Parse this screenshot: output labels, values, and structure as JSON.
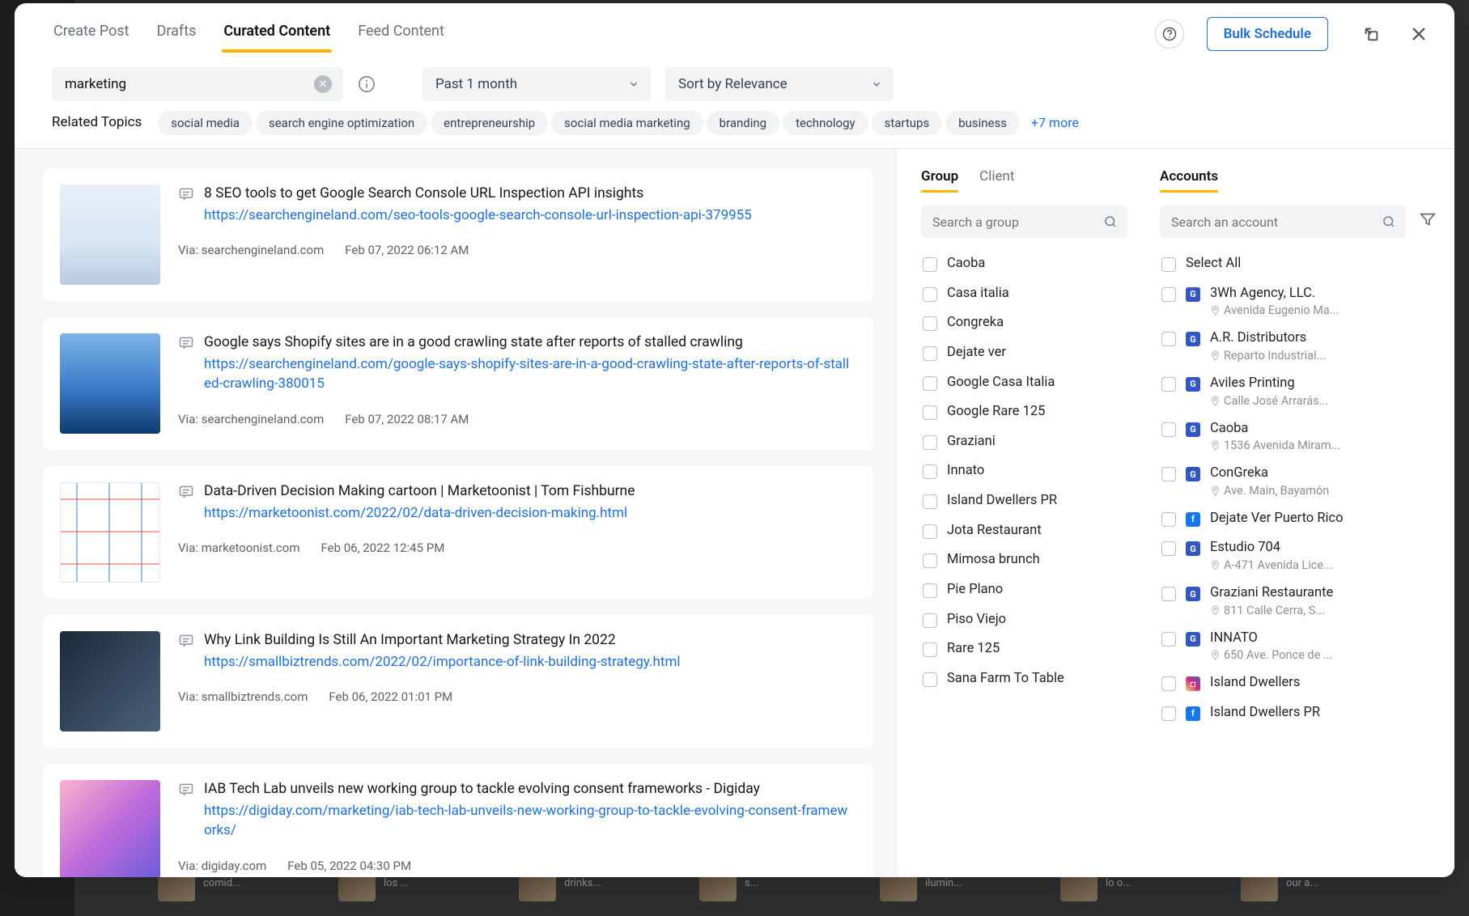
{
  "header": {
    "tabs": [
      "Create Post",
      "Drafts",
      "Curated Content",
      "Feed Content"
    ],
    "active_tab": 2,
    "bulk_schedule": "Bulk Schedule"
  },
  "search": {
    "value": "marketing",
    "time_filter": "Past 1 month",
    "sort": "Sort by Relevance"
  },
  "topics": {
    "label": "Related Topics",
    "items": [
      "social media",
      "search engine optimization",
      "entrepreneurship",
      "social media marketing",
      "branding",
      "technology",
      "startups",
      "business"
    ],
    "more": "+7 more"
  },
  "results": [
    {
      "title": "8 SEO tools to get Google Search Console URL Inspection API insights",
      "url": "https://searchengineland.com/seo-tools-google-search-console-url-inspection-api-379955",
      "via": "Via: searchengineland.com",
      "date": "Feb 07, 2022 06:12 AM",
      "thumb": "th1"
    },
    {
      "title": "Google says Shopify sites are in a good crawling state after reports of stalled crawling",
      "url": "https://searchengineland.com/google-says-shopify-sites-are-in-a-good-crawling-state-after-reports-of-stalled-crawling-380015",
      "via": "Via: searchengineland.com",
      "date": "Feb 07, 2022 08:17 AM",
      "thumb": "th2"
    },
    {
      "title": "Data-Driven Decision Making cartoon | Marketoonist | Tom Fishburne",
      "url": "https://marketoonist.com/2022/02/data-driven-decision-making.html",
      "via": "Via: marketoonist.com",
      "date": "Feb 06, 2022 12:45 PM",
      "thumb": "th3"
    },
    {
      "title": "Why Link Building Is Still An Important Marketing Strategy In 2022",
      "url": "https://smallbiztrends.com/2022/02/importance-of-link-building-strategy.html",
      "via": "Via: smallbiztrends.com",
      "date": "Feb 06, 2022 01:01 PM",
      "thumb": "th4"
    },
    {
      "title": "IAB Tech Lab unveils new working group to tackle evolving consent frameworks - Digiday",
      "url": "https://digiday.com/marketing/iab-tech-lab-unveils-new-working-group-to-tackle-evolving-consent-frameworks/",
      "via": "Via: digiday.com",
      "date": "Feb 05, 2022 04:30 PM",
      "thumb": "th5"
    }
  ],
  "group_panel": {
    "tabs": [
      "Group",
      "Client"
    ],
    "active": 0,
    "search_placeholder": "Search a group",
    "items": [
      "Caoba",
      "Casa italia",
      "Congreka",
      "Dejate ver",
      "Google Casa Italia",
      "Google Rare 125",
      "Graziani",
      "Innato",
      "Island Dwellers PR",
      "Jota Restaurant",
      "Mimosa brunch",
      "Pie Plano",
      "Piso Viejo",
      "Rare 125",
      "Sana Farm To Table"
    ]
  },
  "accounts_panel": {
    "tab": "Accounts",
    "search_placeholder": "Search an account",
    "select_all": "Select All",
    "items": [
      {
        "name": "3Wh Agency, LLC.",
        "sub": "Avenida Eugenio Ma...",
        "net": "gmb"
      },
      {
        "name": "A.R. Distributors",
        "sub": "Reparto Industrial...",
        "net": "gmb"
      },
      {
        "name": "Aviles Printing",
        "sub": "Calle José Arrarás...",
        "net": "gmb"
      },
      {
        "name": "Caoba",
        "sub": "1536 Avenida Miram...",
        "net": "gmb"
      },
      {
        "name": "ConGreka",
        "sub": "Ave. Main, Bayamón",
        "net": "gmb"
      },
      {
        "name": "Dejate Ver Puerto Rico",
        "sub": "",
        "net": "fb"
      },
      {
        "name": "Estudio 704",
        "sub": "A-471 Avenida Lice...",
        "net": "gmb"
      },
      {
        "name": "Graziani Restaurante",
        "sub": "811 Calle Cerra, S...",
        "net": "gmb"
      },
      {
        "name": "INNATO",
        "sub": "650 Ave. Ponce de ...",
        "net": "gmb"
      },
      {
        "name": "Island Dwellers",
        "sub": "",
        "net": "ig"
      },
      {
        "name": "Island Dwellers PR",
        "sub": "",
        "net": "fb"
      }
    ]
  },
  "bg_posts": [
    "El desayuno 🍳🍓es una comid...",
    "El principal enemigo de los ...",
    "Bigger spaces, bigger drinks...",
    "If you are in the mood for s...",
    "Variedad de equipo de ilumin...",
    "Nada sabe tan bien como lo o...",
    "Nothing can compare to our a..."
  ]
}
